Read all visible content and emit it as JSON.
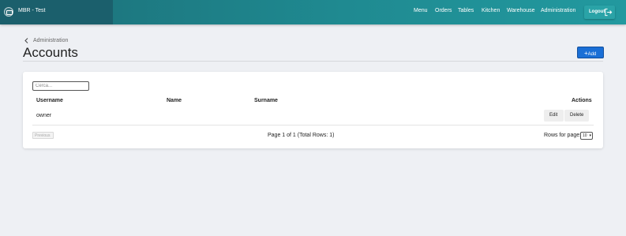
{
  "app": {
    "title": "MBR - Test"
  },
  "nav": {
    "items": [
      "Menu",
      "Orders",
      "Tables",
      "Kitchen",
      "Warehouse",
      "Administration"
    ],
    "logout_label": "Logout"
  },
  "header": {
    "breadcrumb": "Administration",
    "title": "Accounts",
    "add_label": "Add"
  },
  "search": {
    "placeholder": "Cerca..."
  },
  "table": {
    "columns": [
      "Username",
      "Name",
      "Surname",
      "Actions"
    ],
    "rows": [
      {
        "username": "owner",
        "name": "",
        "surname": "",
        "edit_label": "Edit",
        "delete_label": "Delete"
      }
    ]
  },
  "pagination": {
    "previous_label": "Previous",
    "page_info": "Page 1 of 1 (Total Rows: 1)",
    "rows_label": "Rows for page:",
    "rows_value": "10"
  },
  "colors": {
    "accent": "#1a6fd6",
    "topbar": "#1f8a91"
  }
}
